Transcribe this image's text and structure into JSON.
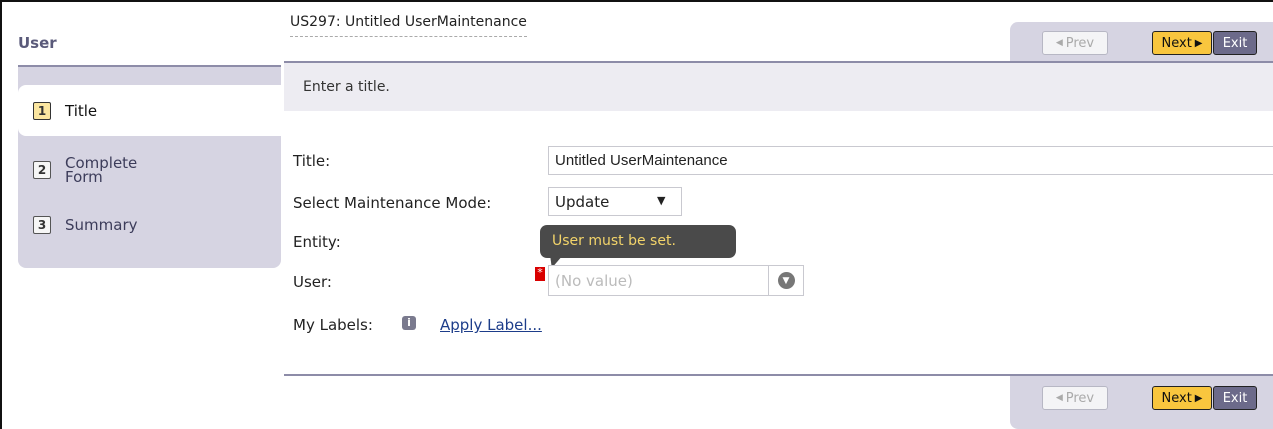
{
  "sidebar": {
    "title": "User",
    "items": [
      {
        "num": "1",
        "label": "Title"
      },
      {
        "num": "2",
        "label": "Complete Form"
      },
      {
        "num": "3",
        "label": "Summary"
      }
    ]
  },
  "header": {
    "title": "US297: Untitled UserMaintenance"
  },
  "nav": {
    "prev": "Prev",
    "next": "Next",
    "exit": "Exit"
  },
  "instruction": "Enter a title.",
  "form": {
    "title_label": "Title:",
    "title_value": "Untitled UserMaintenance",
    "mode_label": "Select Maintenance Mode:",
    "mode_value": "Update",
    "entity_label": "Entity:",
    "user_label": "User:",
    "user_placeholder": "(No value)",
    "user_error": "User must be set.",
    "required_mark": "*",
    "labels_label": "My Labels:",
    "apply_label": "Apply Label..."
  },
  "icons": {
    "info": "info-icon",
    "dropdown": "chevron-down-circle-icon",
    "prev": "triangle-left-icon",
    "next": "triangle-right-icon"
  }
}
